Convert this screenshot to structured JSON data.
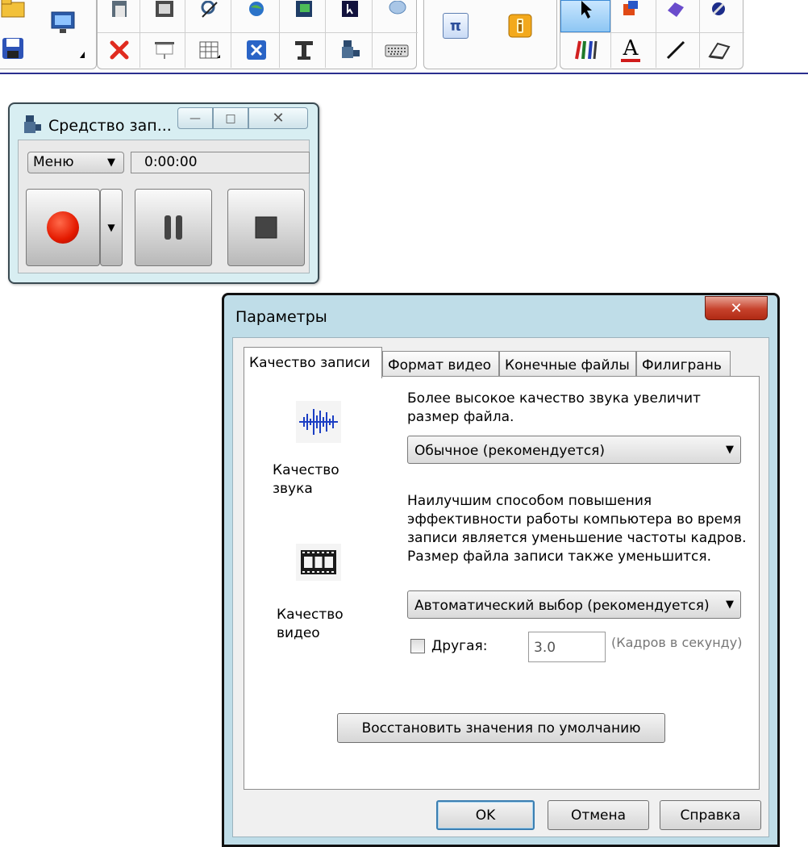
{
  "toolbar": {
    "pi_glyph": "π",
    "text_glyph": "A"
  },
  "recorder": {
    "title": "Средство зап...",
    "menu_label": "Меню",
    "time": "0:00:00",
    "min_glyph": "—",
    "max_glyph": "□",
    "close_glyph": "✕"
  },
  "dialog": {
    "title": "Параметры",
    "close_glyph": "✕",
    "tabs": [
      {
        "label": "Качество записи"
      },
      {
        "label": "Формат видео"
      },
      {
        "label": "Конечные файлы"
      },
      {
        "label": "Филигрань"
      }
    ],
    "audio_section_label_1": "Качество",
    "audio_section_label_2": "звука",
    "video_section_label_1": "Качество",
    "video_section_label_2": "видео",
    "audio_hint_1": "Более высокое качество звука увеличит",
    "audio_hint_2": "размер файла.",
    "audio_quality_value": "Обычное (рекомендуется)",
    "video_hint_1": "Наилучшим способом повышения",
    "video_hint_2": "эффективности работы компьютера во время",
    "video_hint_3": "записи является уменьшение частоты кадров.",
    "video_hint_4": "Размер файла записи также уменьшится.",
    "video_quality_value": "Автоматический выбор (рекомендуется)",
    "other_label": "Другая:",
    "fps_value": "3.0",
    "fps_unit": "(Кадров в секунду)",
    "restore_label": "Восстановить значения по умолчанию",
    "ok_label": "OK",
    "cancel_label": "Отмена",
    "help_label": "Справка"
  },
  "colors": {
    "accent_blue": "#2b2f8f",
    "record_red": "#e41a00",
    "close_red": "#c6412b",
    "window_frame": "#bfdde8"
  }
}
